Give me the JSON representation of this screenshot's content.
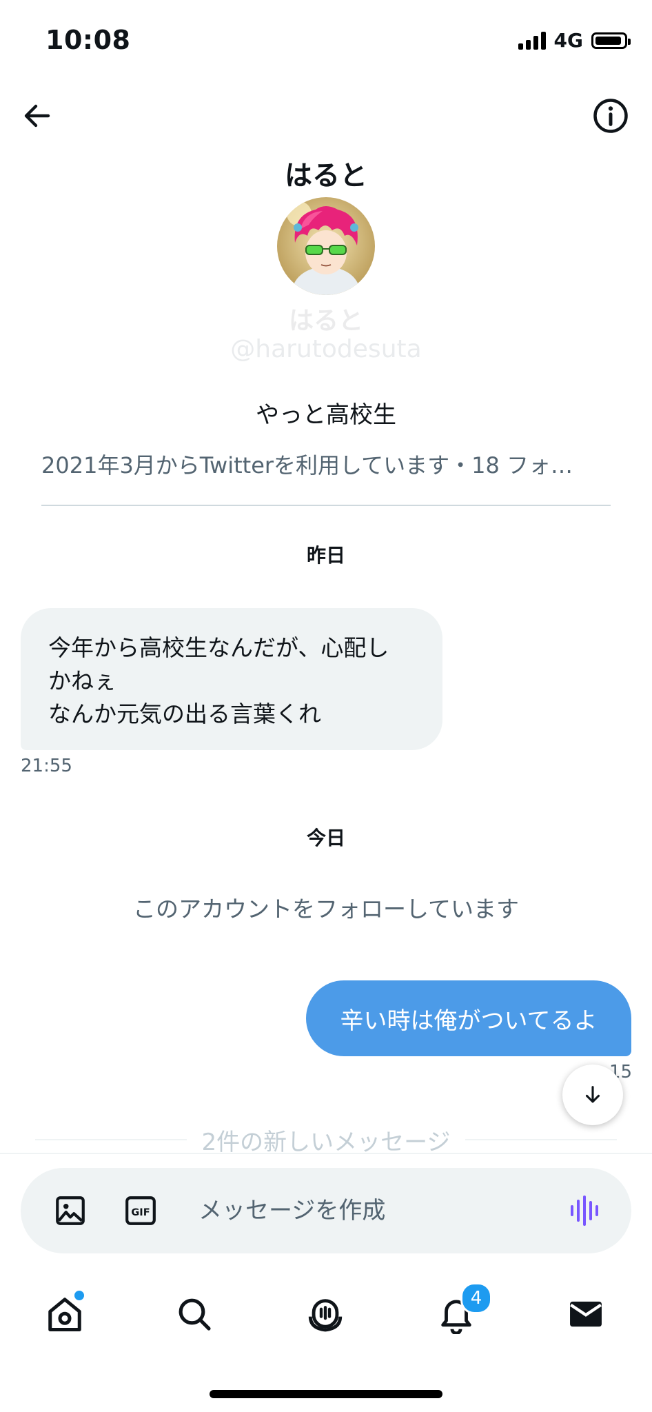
{
  "status_bar": {
    "time": "10:08",
    "network": "4G"
  },
  "header": {
    "title": "はると"
  },
  "profile": {
    "name": "はると",
    "handle": "@harutodesuta",
    "bio": "やっと高校生",
    "meta": "2021年3月からTwitterを利用しています・18 フォ…"
  },
  "conversation": {
    "day_yesterday": "昨日",
    "incoming": {
      "lines": [
        "今年から高校生なんだが、心配し",
        "かねぇ",
        "なんか元気の出る言葉くれ"
      ],
      "time": "21:55"
    },
    "day_today": "今日",
    "follow_notice": "このアカウントをフォローしています",
    "outgoing": {
      "text": "辛い時は俺がついてるよ",
      "time": "15"
    },
    "new_messages": "2件の新しいメッセージ"
  },
  "composer": {
    "placeholder": "メッセージを作成",
    "gif_label": "GIF"
  },
  "tab_bar": {
    "notifications_badge": "4"
  },
  "colors": {
    "accent": "#1d9bf0",
    "outgoing_bubble": "#4c9be8",
    "incoming_bubble": "#eff3f4",
    "voice": "#7856ff"
  }
}
